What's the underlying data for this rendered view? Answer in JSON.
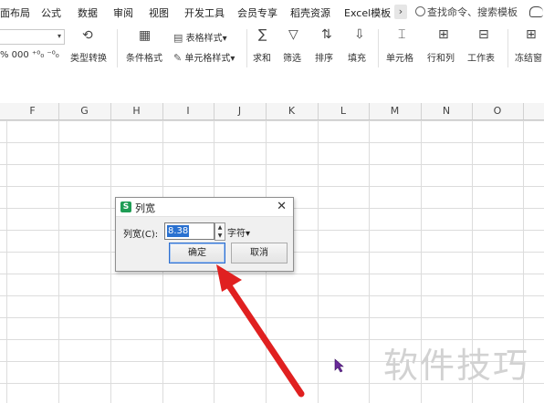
{
  "menu": {
    "items": [
      "面布局",
      "公式",
      "数据",
      "审阅",
      "视图",
      "开发工具",
      "会员专享",
      "稻壳资源",
      "Excel模板"
    ],
    "more": "›",
    "search_text": "查找命令、搜索模板"
  },
  "ribbon": {
    "number_format_row": "%  000  ⁺⁰₀  ⁻⁰₀",
    "type_convert": "类型转换",
    "conditional_format": "条件格式",
    "table_style": "表格样式",
    "cell_style": "单元格样式",
    "sum": "求和",
    "filter": "筛选",
    "sort": "排序",
    "fill": "填充",
    "cell": "单元格",
    "row_col": "行和列",
    "worksheet": "工作表",
    "freeze": "冻结窗"
  },
  "columns": [
    "F",
    "G",
    "H",
    "I",
    "J",
    "K",
    "L",
    "M",
    "N",
    "O"
  ],
  "dialog": {
    "title": "列宽",
    "field_label": "列宽(C):",
    "value": "8.38",
    "unit": "字符",
    "ok": "确定",
    "cancel": "取消",
    "app_icon_letter": "S"
  },
  "watermark": "软件技巧",
  "colors": {
    "arrow": "#e02020",
    "app_icon": "#1f9d55",
    "selection": "#2a71d0",
    "cursor": "#6a2a9a"
  }
}
